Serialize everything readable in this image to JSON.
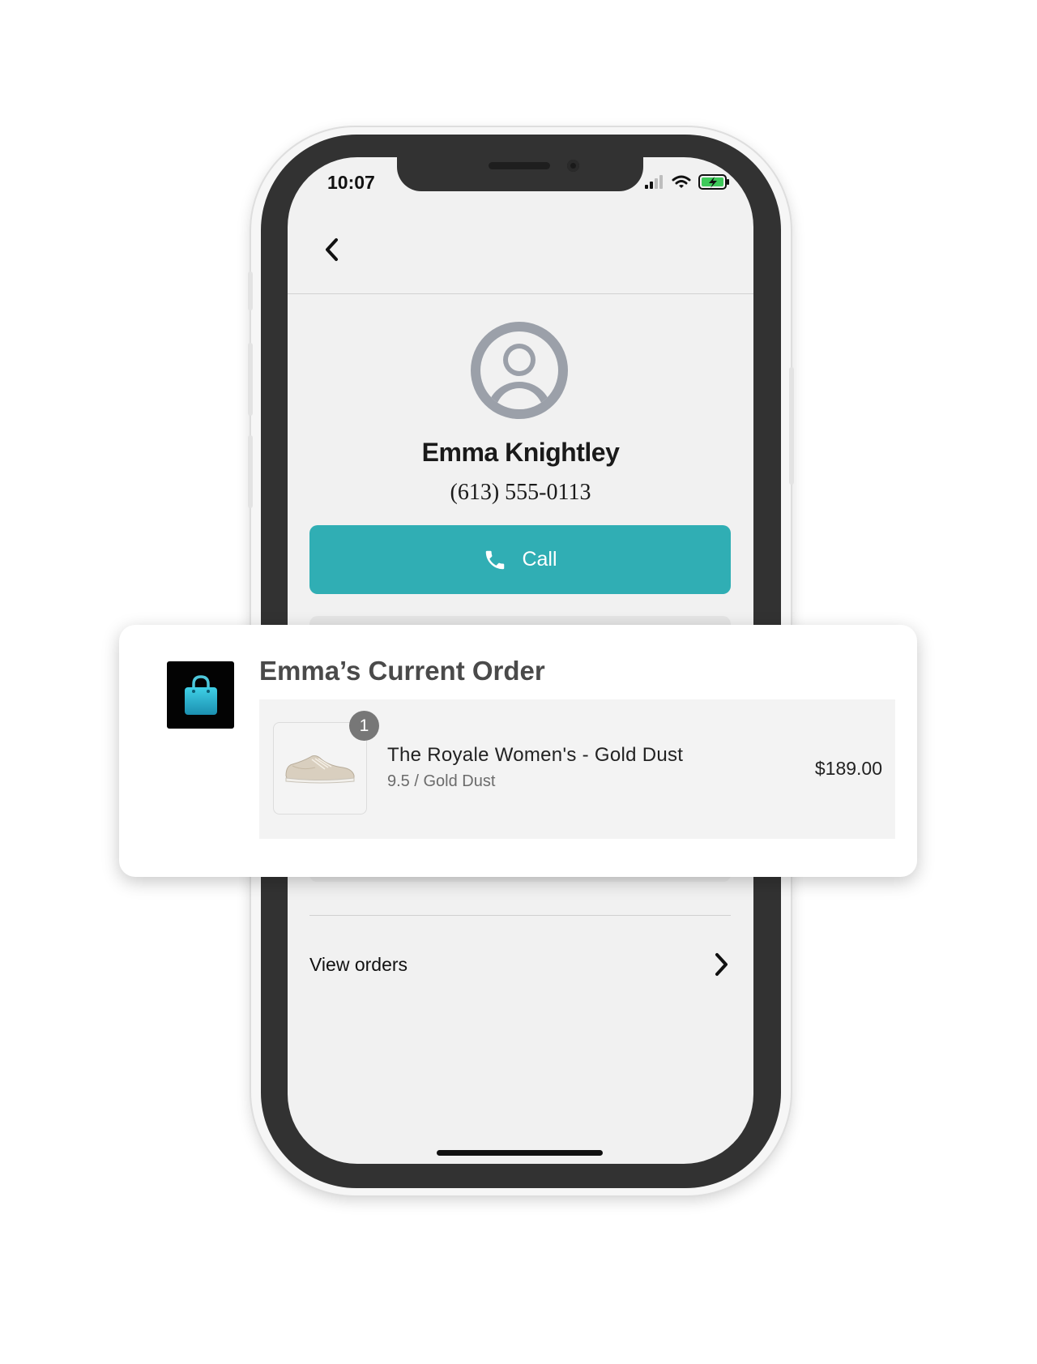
{
  "status_bar": {
    "time": "10:07"
  },
  "contact": {
    "name": "Emma Knightley",
    "phone": "(613) 555-0113",
    "call_label": "Call"
  },
  "view_orders_label": "View orders",
  "order_card": {
    "title": "Emma’s Current Order",
    "item": {
      "quantity": "1",
      "title": "The Royale Women's - Gold Dust",
      "variant": "9.5 / Gold Dust",
      "price": "$189.00"
    }
  },
  "icons": {
    "back": "chevron-left-icon",
    "avatar": "user-avatar-icon",
    "call": "phone-icon",
    "view_orders": "chevron-right-icon",
    "store": "shopping-bag-icon",
    "signal": "cellular-signal-icon",
    "wifi": "wifi-icon",
    "battery": "battery-charging-icon"
  },
  "colors": {
    "accent": "#30aeb4",
    "screen_bg": "#f1f1f1",
    "bezel": "#323232",
    "battery": "#3ec95a"
  }
}
